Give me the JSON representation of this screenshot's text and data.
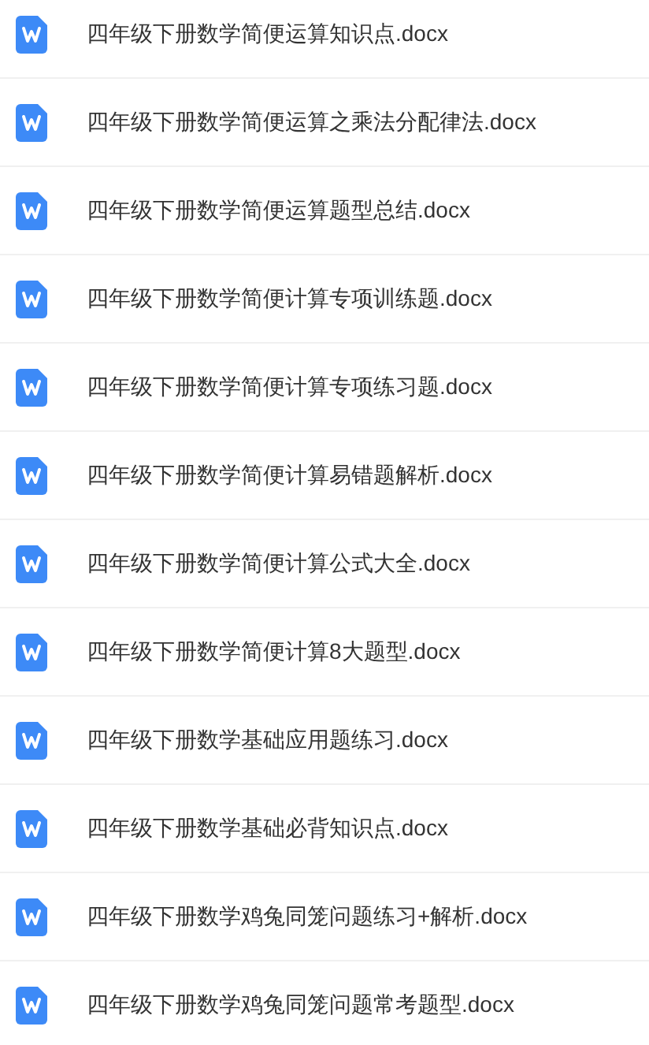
{
  "files": [
    {
      "name": "四年级下册数学简便运算知识点.docx"
    },
    {
      "name": "四年级下册数学简便运算之乘法分配律法.docx"
    },
    {
      "name": "四年级下册数学简便运算题型总结.docx"
    },
    {
      "name": "四年级下册数学简便计算专项训练题.docx"
    },
    {
      "name": "四年级下册数学简便计算专项练习题.docx"
    },
    {
      "name": "四年级下册数学简便计算易错题解析.docx"
    },
    {
      "name": "四年级下册数学简便计算公式大全.docx"
    },
    {
      "name": "四年级下册数学简便计算8大题型.docx"
    },
    {
      "name": "四年级下册数学基础应用题练习.docx"
    },
    {
      "name": "四年级下册数学基础必背知识点.docx"
    },
    {
      "name": "四年级下册数学鸡兔同笼问题练习+解析.docx"
    },
    {
      "name": "四年级下册数学鸡兔同笼问题常考题型.docx"
    }
  ]
}
